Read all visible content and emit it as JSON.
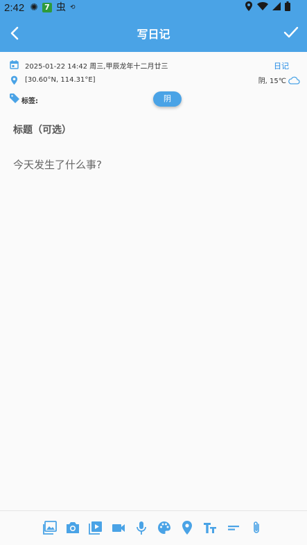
{
  "status_bar": {
    "time": "2:42",
    "notification_badge": "7",
    "notification_text": "虫"
  },
  "app_bar": {
    "title": "写日记"
  },
  "meta": {
    "datetime": "2025-01-22 14:42 周三,甲辰龙年十二月廿三",
    "diary_link": "日记",
    "location": "[30.60°N, 114.31°E]",
    "weather": "阴, 15℃"
  },
  "tags": {
    "label": "标签:",
    "chip": "阴"
  },
  "editor": {
    "title_placeholder": "标题（可选）",
    "body_placeholder": "今天发生了什么事?"
  },
  "toolbar": {
    "icons": [
      "image-icon",
      "camera-icon",
      "video-library-icon",
      "videocam-icon",
      "mic-icon",
      "palette-icon",
      "location-icon",
      "text-size-icon",
      "short-text-icon",
      "attachment-icon"
    ]
  },
  "colors": {
    "primary": "#4aa3e6",
    "link": "#1e88e5",
    "background": "#fafafa"
  }
}
